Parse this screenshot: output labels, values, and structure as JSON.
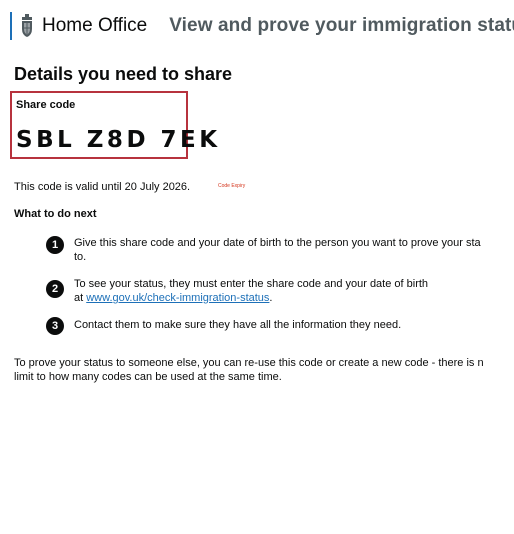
{
  "header": {
    "crest_icon": "royal-coat-of-arms-icon",
    "organisation": "Home Office",
    "service_name": "View and prove your immigration status",
    "accent_color": "#1d70b8"
  },
  "main": {
    "title": "Details you need to share",
    "share_box": {
      "label": "Share code",
      "code": "SBL Z8D 7EK",
      "border_color": "#b7323d"
    },
    "validity_text": "This code is valid until 20 July 2026.",
    "expiry_note": "Code Expiry",
    "next_heading": "What to do next",
    "steps": [
      {
        "number": "1",
        "line1": "Give this share code and your date of birth to the person you want to prove your sta",
        "line2": "to."
      },
      {
        "number": "2",
        "line1": "To see your status, they must enter the share code and your date of birth",
        "line2_prefix": "at ",
        "link": "www.gov.uk/check-immigration-status",
        "line2_suffix": "."
      },
      {
        "number": "3",
        "line1": "Contact them to make sure they have all the information they need."
      }
    ],
    "reuse_line1": "To prove your status to someone else, you can re-use this code or create a new code - there is n",
    "reuse_line2": "limit to how many codes can be used at the same time."
  }
}
